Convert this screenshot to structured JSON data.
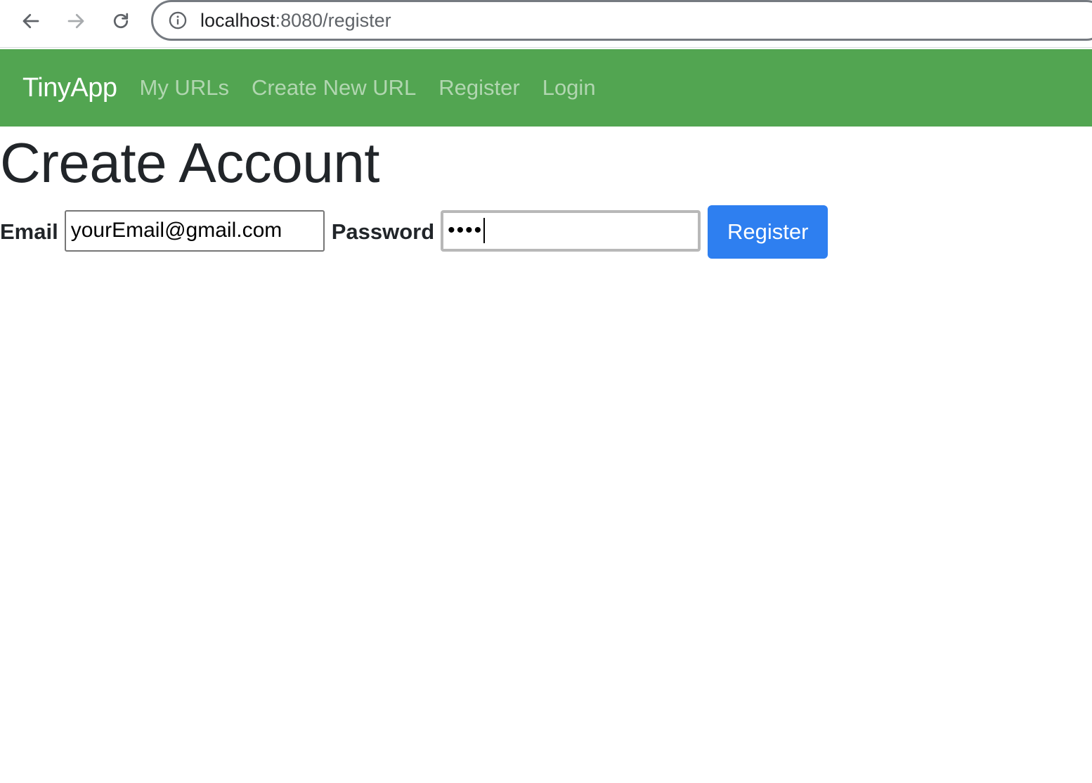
{
  "browser": {
    "back_icon": "arrow-left-icon",
    "forward_icon": "arrow-right-icon",
    "reload_icon": "reload-icon",
    "site_info_icon": "info-icon",
    "url_host": "localhost",
    "url_path": ":8080/register"
  },
  "navbar": {
    "brand": "TinyApp",
    "background_color": "#52a551",
    "links": [
      {
        "label": "My URLs"
      },
      {
        "label": "Create New URL"
      },
      {
        "label": "Register"
      },
      {
        "label": "Login"
      }
    ]
  },
  "page": {
    "title": "Create Account"
  },
  "form": {
    "email_label": "Email",
    "email_value": "yourEmail@gmail.com",
    "password_label": "Password",
    "password_masked": "••••",
    "submit_label": "Register",
    "submit_color": "#2e7ff0"
  }
}
